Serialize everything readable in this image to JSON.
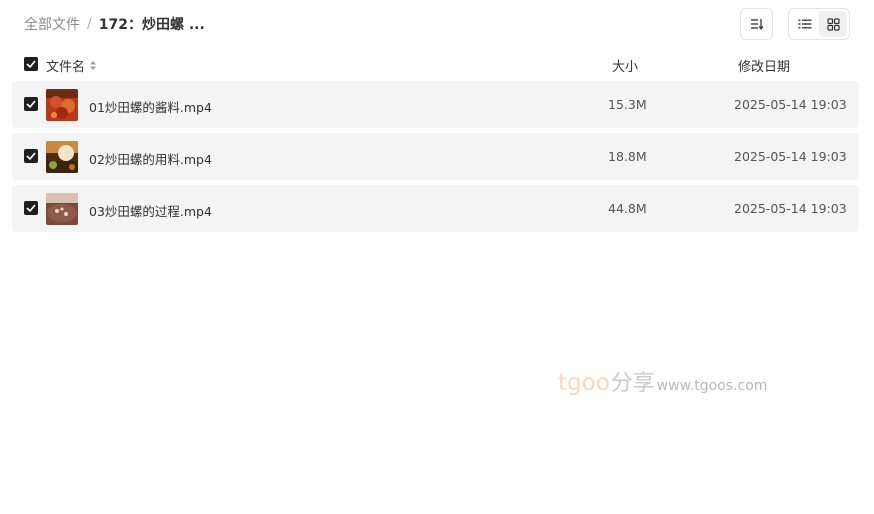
{
  "breadcrumb": {
    "root": "全部文件",
    "separator": "/",
    "current": "172：炒田螺 ..."
  },
  "toolbar": {
    "sort_icon": "sort-icon",
    "list_view_icon": "list-view-icon",
    "grid_view_icon": "grid-view-icon"
  },
  "columns": {
    "name": "文件名",
    "size": "大小",
    "modified": "修改日期"
  },
  "files": [
    {
      "name": "01炒田螺的酱料.mp4",
      "size": "15.3M",
      "modified": "2025-05-14 19:03",
      "checked": true
    },
    {
      "name": "02炒田螺的用料.mp4",
      "size": "18.8M",
      "modified": "2025-05-14 19:03",
      "checked": true
    },
    {
      "name": "03炒田螺的过程.mp4",
      "size": "44.8M",
      "modified": "2025-05-14 19:03",
      "checked": true
    }
  ],
  "watermark": {
    "brand": "tgoo",
    "share": "分享",
    "url": "www.tgoos.com"
  },
  "colors": {
    "row_bg": "#f4f4f4",
    "checkbox": "#1f1f1f",
    "watermark_brand": "#fad9b6"
  }
}
